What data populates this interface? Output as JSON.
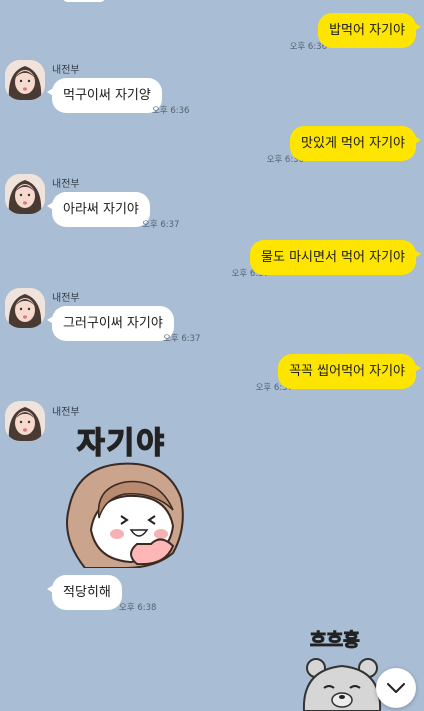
{
  "sender_name": "내전부",
  "messages": [
    {
      "from": "me",
      "text": "밥먹어 자기야",
      "time": "오후 6:36"
    },
    {
      "from": "them",
      "text": "먹구이써 자기양",
      "time": "오후 6:36"
    },
    {
      "from": "me",
      "text": "맛있게 먹어 자기야",
      "time": "오후 6:36"
    },
    {
      "from": "them",
      "text": "아라써 자기야",
      "time": "오후 6:37"
    },
    {
      "from": "me",
      "text": "물도 마시면서 먹어 자기야",
      "time": "오후 6:37"
    },
    {
      "from": "them",
      "text": "그러구이써 자기야",
      "time": "오후 6:37"
    },
    {
      "from": "me",
      "text": "꼭꼭 씹어먹어 자기야",
      "time": "오후 6:37"
    },
    {
      "from": "them",
      "text": "적당히해",
      "time": "오후 6:38"
    }
  ],
  "stickers": {
    "girl_caption": "자기야",
    "bear_caption": "흐흐흥"
  },
  "icons": {
    "scroll_down": "chevron-down-icon"
  },
  "colors": {
    "background": "#a9bdd4",
    "my_bubble": "#fee500",
    "their_bubble": "#ffffff"
  }
}
